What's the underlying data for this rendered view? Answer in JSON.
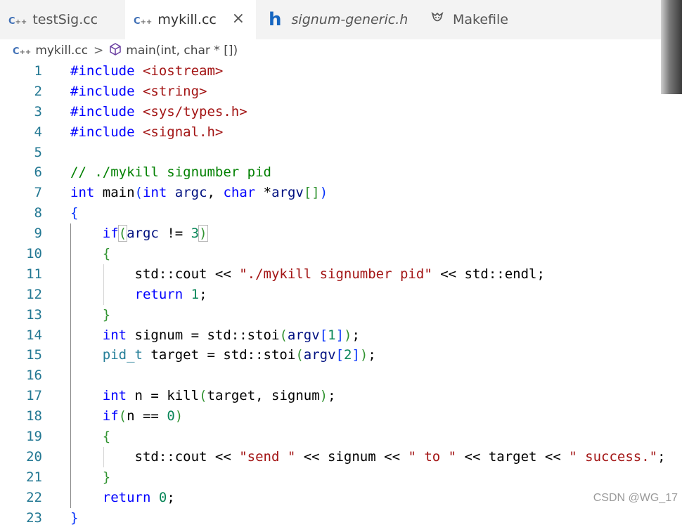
{
  "tabs": [
    {
      "icon": "C++",
      "label": "testSig.cc",
      "active": false
    },
    {
      "icon": "C++",
      "label": "mykill.cc",
      "active": true,
      "close": "×"
    },
    {
      "icon": "h",
      "label": "signum-generic.h",
      "active": false
    },
    {
      "icon": "makefile-icon",
      "label": "Makefile",
      "active": false
    }
  ],
  "breadcrumb": {
    "file": "mykill.cc",
    "separator": ">",
    "symbol": "main(int, char * [])"
  },
  "code": {
    "line_numbers": [
      "1",
      "2",
      "3",
      "4",
      "5",
      "6",
      "7",
      "8",
      "9",
      "10",
      "11",
      "12",
      "13",
      "14",
      "15",
      "16",
      "17",
      "18",
      "19",
      "20",
      "21",
      "22",
      "23"
    ]
  },
  "watermark": "CSDN @WG_17"
}
